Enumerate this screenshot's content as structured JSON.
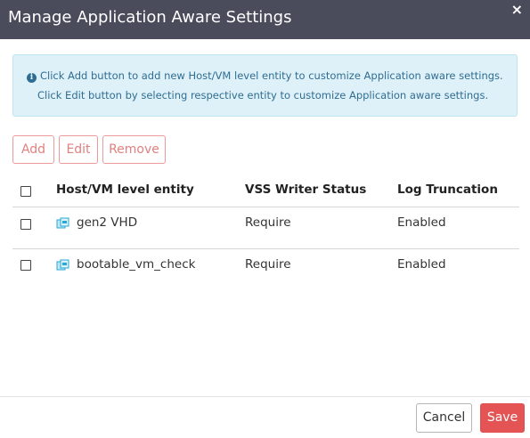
{
  "dialog": {
    "title": "Manage Application Aware Settings",
    "close_glyph": "×"
  },
  "info": {
    "icon": "info-circle-icon",
    "line1": "Click Add button to add new Host/VM level entity to customize Application aware settings.",
    "line2": "Click Edit button by selecting respective entity to customize Application aware settings."
  },
  "toolbar": {
    "add_label": "Add",
    "edit_label": "Edit",
    "remove_label": "Remove"
  },
  "table": {
    "headers": {
      "entity": "Host/VM level entity",
      "vss": "VSS Writer Status",
      "log": "Log Truncation"
    },
    "rows": [
      {
        "entity": "gen2 VHD",
        "icon": "vm-icon",
        "vss": "Require",
        "log": "Enabled",
        "checked": false
      },
      {
        "entity": "bootable_vm_check",
        "icon": "vm-icon",
        "vss": "Require",
        "log": "Enabled",
        "checked": false
      }
    ]
  },
  "footer": {
    "cancel_label": "Cancel",
    "save_label": "Save"
  },
  "colors": {
    "titlebar": "#4a4c5c",
    "info_bg": "#dff1f8",
    "info_text": "#2f6d93",
    "accent_red": "#e45454"
  }
}
